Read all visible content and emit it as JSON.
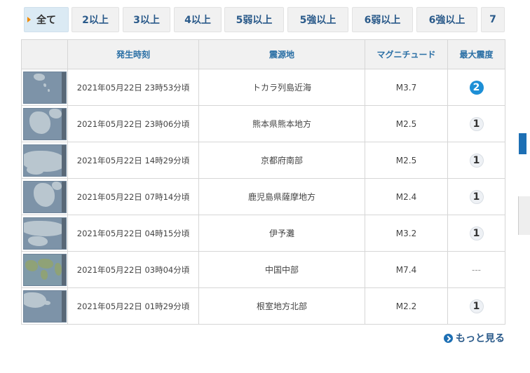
{
  "tabs": [
    {
      "label": "全て",
      "active": true
    },
    {
      "label": "2以上"
    },
    {
      "label": "3以上"
    },
    {
      "label": "4以上"
    },
    {
      "label": "5弱以上"
    },
    {
      "label": "5強以上"
    },
    {
      "label": "6弱以上"
    },
    {
      "label": "6強以上"
    },
    {
      "label": "7"
    }
  ],
  "table": {
    "headers": {
      "time": "発生時刻",
      "epicenter": "震源地",
      "magnitude": "マグニチュード",
      "intensity": "最大震度"
    },
    "rows": [
      {
        "time": "2021年05月22日 23時53分頃",
        "epicenter": "トカラ列島近海",
        "magnitude": "M3.7",
        "intensity": "2",
        "map": "japan-south-map"
      },
      {
        "time": "2021年05月22日 23時06分頃",
        "epicenter": "熊本県熊本地方",
        "magnitude": "M2.5",
        "intensity": "1",
        "map": "kyushu-map"
      },
      {
        "time": "2021年05月22日 14時29分頃",
        "epicenter": "京都府南部",
        "magnitude": "M2.5",
        "intensity": "1",
        "map": "kinki-map"
      },
      {
        "time": "2021年05月22日 07時14分頃",
        "epicenter": "鹿児島県薩摩地方",
        "magnitude": "M2.4",
        "intensity": "1",
        "map": "kyushu-map"
      },
      {
        "time": "2021年05月22日 04時15分頃",
        "epicenter": "伊予灘",
        "magnitude": "M3.2",
        "intensity": "1",
        "map": "shikoku-map"
      },
      {
        "time": "2021年05月22日 03時04分頃",
        "epicenter": "中国中部",
        "magnitude": "M7.4",
        "intensity": "---",
        "map": "world-map"
      },
      {
        "time": "2021年05月22日 01時29分頃",
        "epicenter": "根室地方北部",
        "magnitude": "M2.2",
        "intensity": "1",
        "map": "hokkaido-map"
      }
    ]
  },
  "more_link": "もっと見る",
  "colors": {
    "link": "#2a6fa5",
    "intensity2": "#1d8fd6",
    "active_tab": "#dbeaf4",
    "tab_caret": "#f08a00"
  }
}
